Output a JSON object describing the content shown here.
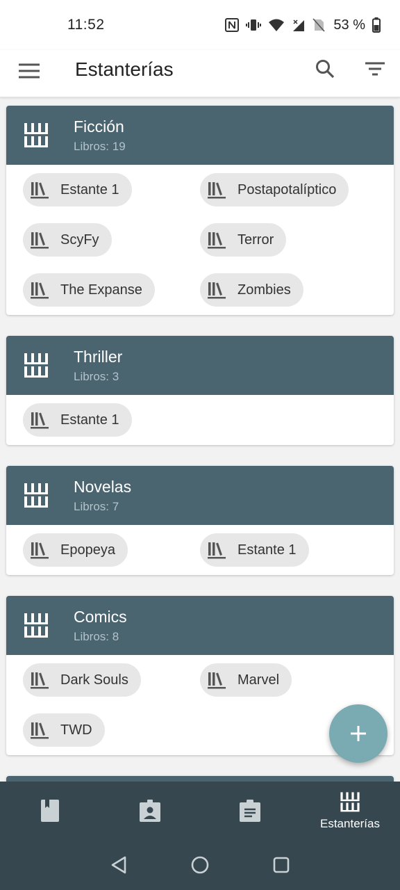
{
  "status_bar": {
    "time": "11:52",
    "battery": "53 %"
  },
  "app_bar": {
    "title": "Estanterías",
    "icons": [
      "menu-icon",
      "search-icon",
      "filter-icon"
    ]
  },
  "categories": [
    {
      "title": "Ficción",
      "count": "Libros: 19",
      "shelves": [
        "Estante 1",
        "Postapotalíptico",
        "ScyFy",
        "Terror",
        "The Expanse",
        "Zombies"
      ]
    },
    {
      "title": "Thriller",
      "count": "Libros: 3",
      "shelves": [
        "Estante 1"
      ]
    },
    {
      "title": "Novelas",
      "count": "Libros: 7",
      "shelves": [
        "Epopeya",
        "Estante 1"
      ]
    },
    {
      "title": "Comics",
      "count": "Libros: 8",
      "shelves": [
        "Dark Souls",
        "Marvel",
        "TWD"
      ]
    }
  ],
  "fab": {
    "icon": "plus-icon"
  },
  "bottom_nav": {
    "items": [
      {
        "icon": "book-icon",
        "label": ""
      },
      {
        "icon": "author-icon",
        "label": ""
      },
      {
        "icon": "clipboard-icon",
        "label": ""
      },
      {
        "icon": "shelf-icon",
        "label": "Estanterías"
      }
    ],
    "active_index": 3
  },
  "colors": {
    "header": "#4a6470",
    "nav": "#37474f",
    "fab": "#7aaab2",
    "chip": "#e7e7e7"
  }
}
